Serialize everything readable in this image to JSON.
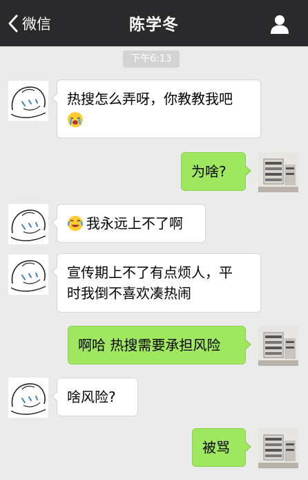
{
  "header": {
    "back_label": "微信",
    "title": "陈学冬"
  },
  "timestamp": "下午6:13",
  "messages": [
    {
      "side": "in",
      "text": "热搜怎么弄呀，你教教我吧",
      "emoji_after": "crying-face-icon"
    },
    {
      "side": "out",
      "text": "为啥?"
    },
    {
      "side": "in",
      "text": "我永远上不了啊",
      "emoji_before": "laughing-tears-icon"
    },
    {
      "side": "in",
      "text_line1": "宣传期上不了有点烦人，平",
      "text_line2": "时我倒不喜欢凑热闹"
    },
    {
      "side": "out",
      "text": "啊哈 热搜需要承担风险"
    },
    {
      "side": "in",
      "text": "啥风险?"
    },
    {
      "side": "out",
      "text": "被骂"
    }
  ],
  "colors": {
    "header_bg": "#2a2a2c",
    "chat_bg": "#ebebeb",
    "incoming_bubble": "#ffffff",
    "outgoing_bubble": "#9fe75f"
  }
}
